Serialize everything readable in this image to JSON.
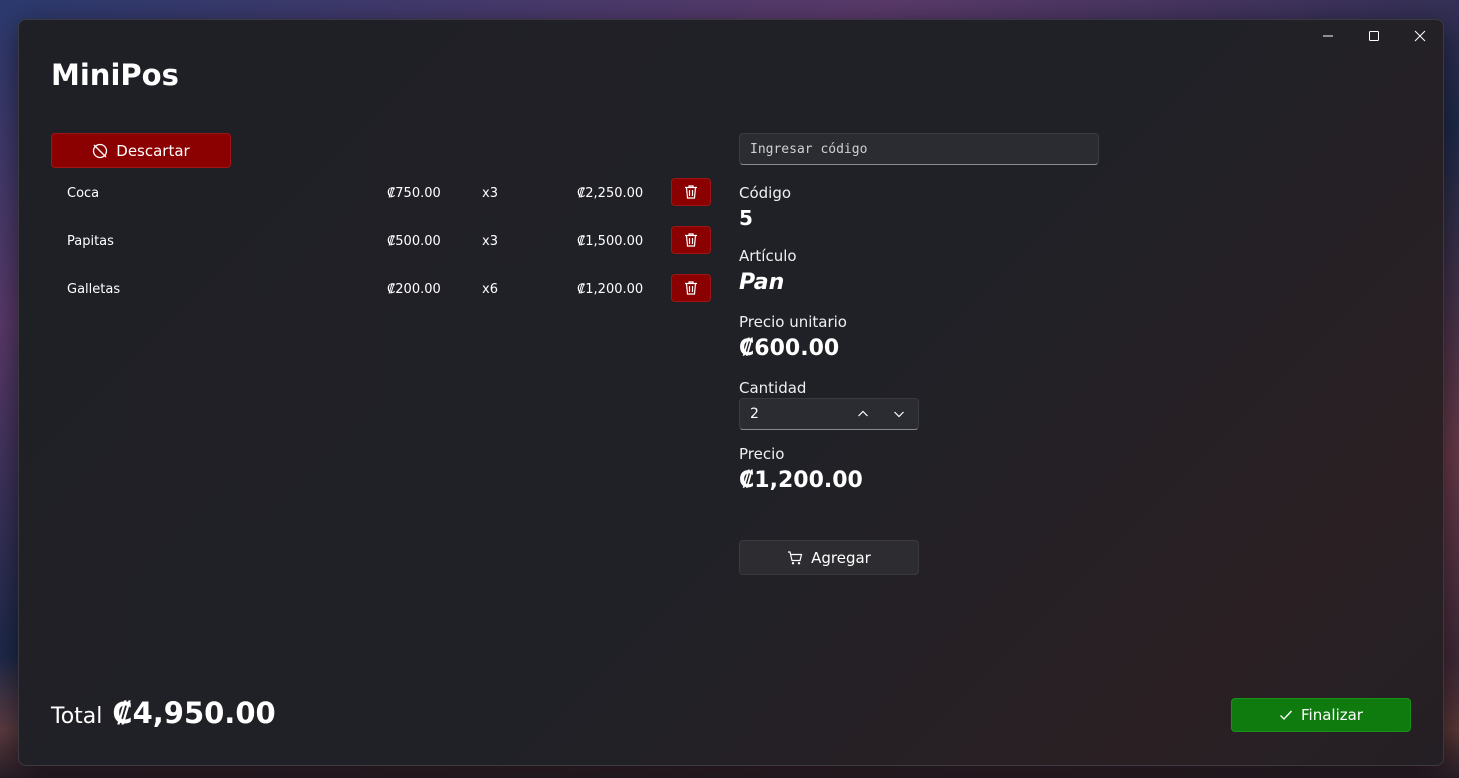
{
  "app": {
    "title": "MiniPos"
  },
  "cart": {
    "discard_label": "Descartar",
    "items": [
      {
        "name": "Coca",
        "unit_price": "₡750.00",
        "qty": "x3",
        "total": "₡2,250.00"
      },
      {
        "name": "Papitas",
        "unit_price": "₡500.00",
        "qty": "x3",
        "total": "₡1,500.00"
      },
      {
        "name": "Galletas",
        "unit_price": "₡200.00",
        "qty": "x6",
        "total": "₡1,200.00"
      }
    ]
  },
  "entry": {
    "code_placeholder": "Ingresar código",
    "code_label": "Código",
    "code_value": "5",
    "item_label": "Artículo",
    "item_value": "Pan",
    "unit_price_label": "Precio unitario",
    "unit_price_value": "₡600.00",
    "qty_label": "Cantidad",
    "qty_value": "2",
    "price_label": "Precio",
    "price_value": "₡1,200.00",
    "add_label": "Agregar"
  },
  "footer": {
    "total_label": "Total",
    "total_value": "₡4,950.00",
    "finalize_label": "Finalizar"
  },
  "colors": {
    "danger": "#8b0000",
    "success": "#0f7b0f",
    "surface": "#202127"
  },
  "icons": [
    "minimize-icon",
    "maximize-icon",
    "close-icon",
    "discard-icon",
    "trash-icon",
    "chevron-up-icon",
    "chevron-down-icon",
    "cart-icon",
    "checkmark-icon"
  ]
}
